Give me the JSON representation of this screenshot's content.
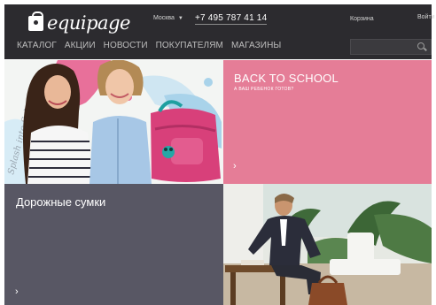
{
  "header": {
    "logo_text": "equipage",
    "city": "Москва",
    "phone": "+7 495 787 41 14",
    "cart_label": "Корзина",
    "login_label": "Войти",
    "nav": [
      {
        "label": "КАТАЛОГ"
      },
      {
        "label": "АКЦИИ"
      },
      {
        "label": "НОВОСТИ"
      },
      {
        "label": "ПОКУПАТЕЛЯМ"
      },
      {
        "label": "МАГАЗИНЫ"
      }
    ],
    "search": {
      "placeholder": "",
      "value": ""
    }
  },
  "tiles": {
    "school": {
      "title": "BACK TO SCHOOL",
      "subtitle": "А ВАШ РЕБЕНОК ГОТОВ?",
      "arrow": "›"
    },
    "bags": {
      "title": "Дорожные сумки",
      "arrow": "›"
    },
    "kids": {
      "script_text": "Splash into School"
    }
  },
  "colors": {
    "header_bg": "#2c2b2f",
    "school_bg": "#e57d97",
    "bags_bg": "#585764",
    "backpack": "#d8407a"
  }
}
